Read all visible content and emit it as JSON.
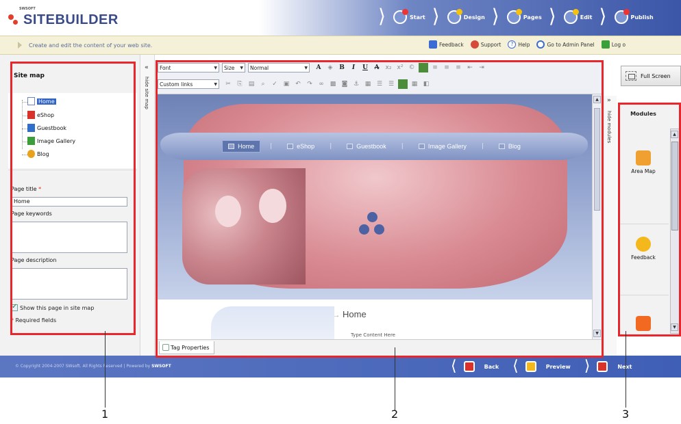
{
  "app": {
    "logo_small": "SWSOFT",
    "logo_text": "SITEBUILDER",
    "subtitle": "Create and edit the content of your web site."
  },
  "steps": [
    {
      "label": "Start"
    },
    {
      "label": "Design"
    },
    {
      "label": "Pages"
    },
    {
      "label": "Edit"
    },
    {
      "label": "Publish"
    }
  ],
  "top_links": [
    {
      "label": "Feedback",
      "icon": "feedback-icon",
      "color": "#3a6bd6"
    },
    {
      "label": "Support",
      "icon": "support-icon",
      "color": "#d64b3a"
    },
    {
      "label": "Help",
      "icon": "help-icon",
      "color": "#3a6bd6"
    },
    {
      "label": "Go to Admin Panel",
      "icon": "admin-panel-icon",
      "color": "#3a6bd6"
    },
    {
      "label": "Log o",
      "icon": "logout-icon",
      "color": "#3aa13a"
    }
  ],
  "sidebar": {
    "title": "Site map",
    "collapse_label": "«",
    "hide_label": "hide site map",
    "tree": [
      {
        "label": "Home",
        "icon": "page-icon",
        "selected": true,
        "color": "#ffffff"
      },
      {
        "label": "eShop",
        "icon": "eshop-icon",
        "color": "#d8322a"
      },
      {
        "label": "Guestbook",
        "icon": "guestbook-icon",
        "color": "#2f6fc9"
      },
      {
        "label": "Image Gallery",
        "icon": "image-gallery-icon",
        "color": "#3b9e3a"
      },
      {
        "label": "Blog",
        "icon": "blog-icon",
        "color": "#e8a21c"
      }
    ],
    "fields": {
      "page_title_label": "Page title",
      "page_title_value": "Home",
      "page_keywords_label": "Page keywords",
      "page_keywords_value": "",
      "page_description_label": "Page description",
      "page_description_value": "",
      "required_mark": "*",
      "show_in_sitemap_label": "Show this page in site map",
      "required_note": "Required fields"
    }
  },
  "editor": {
    "font_select": "Font",
    "size_select": "Size",
    "format_select": "Normal",
    "links_select": "Custom links",
    "nav_items": [
      {
        "label": "Home",
        "active": true
      },
      {
        "label": "eShop"
      },
      {
        "label": "Guestbook"
      },
      {
        "label": "Image Gallery"
      },
      {
        "label": "Blog"
      }
    ],
    "page_heading_arrow": "→",
    "page_heading": "Home",
    "page_body_text": "Type Content Here",
    "tag_properties_label": "Tag Properties"
  },
  "right": {
    "fullscreen_label": "Full Screen",
    "collapse_label": "»",
    "hide_label": "hide modules",
    "modules_title": "Modules",
    "modules": [
      {
        "label": "Area Map",
        "icon": "area-map-icon",
        "color": "#f0a030"
      },
      {
        "label": "Feedback",
        "icon": "feedback-module-icon",
        "color": "#f4b81c"
      },
      {
        "label": "",
        "icon": "rss-icon",
        "color": "#f26a22"
      }
    ]
  },
  "footer": {
    "copyright": "© Copyright 2004-2007 SWsoft. All Rights Reserved",
    "powered_by": "Powered by",
    "powered_brand": "SWSOFT",
    "back_label": "Back",
    "preview_label": "Preview",
    "next_label": "Next"
  },
  "callouts": [
    "1",
    "2",
    "3"
  ],
  "colors": {
    "highlight": "#e8262c",
    "header_blue": "#3b56a8",
    "subbar_bg": "#f4f1d8"
  }
}
